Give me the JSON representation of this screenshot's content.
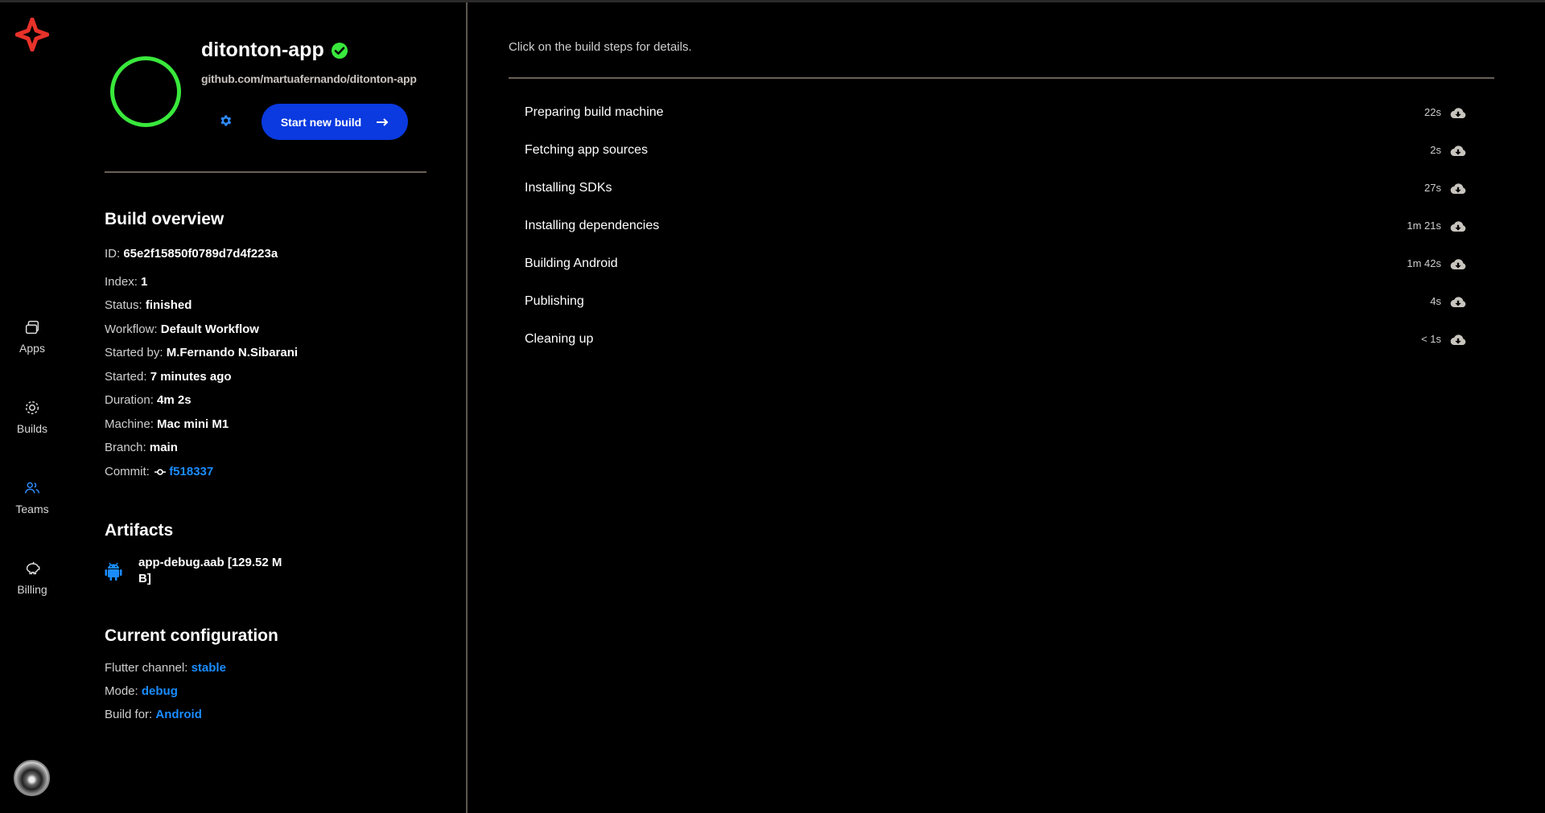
{
  "nav": {
    "items": [
      {
        "label": "Apps",
        "icon": "apps-icon"
      },
      {
        "label": "Builds",
        "icon": "builds-icon"
      },
      {
        "label": "Teams",
        "icon": "teams-icon"
      },
      {
        "label": "Billing",
        "icon": "billing-icon"
      }
    ],
    "active": "Teams"
  },
  "app": {
    "name": "ditonton-app",
    "repo": "github.com/martuafernando/ditonton-app",
    "start_build_label": "Start new build",
    "status_color": "#39e83c"
  },
  "overview": {
    "title": "Build overview",
    "id_label": "ID:",
    "id": "65e2f15850f0789d7d4f223a",
    "index_label": "Index:",
    "index": "1",
    "status_label": "Status:",
    "status": "finished",
    "workflow_label": "Workflow:",
    "workflow": "Default Workflow",
    "started_by_label": "Started by:",
    "started_by": "M.Fernando N.Sibarani",
    "started_label": "Started:",
    "started": "7 minutes ago",
    "duration_label": "Duration:",
    "duration": "4m 2s",
    "machine_label": "Machine:",
    "machine": "Mac mini M1",
    "branch_label": "Branch:",
    "branch": "main",
    "commit_label": "Commit:",
    "commit": "f518337"
  },
  "artifacts": {
    "title": "Artifacts",
    "items": [
      {
        "name": "app-debug.aab [129.52 M B]",
        "icon": "android-icon"
      }
    ]
  },
  "config": {
    "title": "Current configuration",
    "flutter_label": "Flutter channel:",
    "flutter": "stable",
    "mode_label": "Mode:",
    "mode": "debug",
    "build_for_label": "Build for:",
    "build_for": "Android"
  },
  "steps": {
    "hint": "Click on the build steps for details.",
    "items": [
      {
        "name": "Preparing build machine",
        "time": "22s"
      },
      {
        "name": "Fetching app sources",
        "time": "2s"
      },
      {
        "name": "Installing SDKs",
        "time": "27s"
      },
      {
        "name": "Installing dependencies",
        "time": "1m 21s"
      },
      {
        "name": "Building Android",
        "time": "1m 42s"
      },
      {
        "name": "Publishing",
        "time": "4s"
      },
      {
        "name": "Cleaning up",
        "time": "< 1s"
      }
    ]
  },
  "colors": {
    "accent_blue": "#0a3ae0",
    "link_blue": "#1a8cff",
    "success_green": "#39e83c",
    "logo_red": "#e8322a"
  }
}
